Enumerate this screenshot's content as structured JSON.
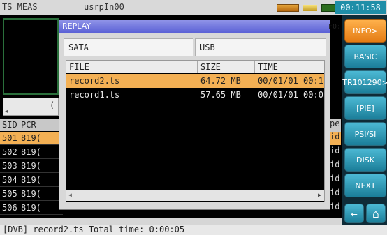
{
  "topbar": {
    "app_title": "TS MEAS",
    "user": "usrpIn00",
    "clock": "00:11:58",
    "icons": [
      "storage-icon",
      "signal-icon",
      "battery-icon"
    ]
  },
  "background_table": {
    "headers": [
      "SID",
      "PCR"
    ],
    "rows": [
      {
        "sid": "501",
        "pcr": "819(",
        "right": "id",
        "selected": true
      },
      {
        "sid": "502",
        "pcr": "819(",
        "right": "id",
        "selected": false
      },
      {
        "sid": "503",
        "pcr": "819(",
        "right": "id",
        "selected": false
      },
      {
        "sid": "504",
        "pcr": "819(",
        "right": "id",
        "selected": false
      },
      {
        "sid": "505",
        "pcr": "819(",
        "right": "id",
        "selected": false
      },
      {
        "sid": "506",
        "pcr": "819(",
        "right": "id",
        "selected": false
      }
    ],
    "right_header": "pe",
    "left_scroll_glyph": "("
  },
  "status_bar": "[DVB] record2.ts Total time: 0:00:05",
  "side_panel": {
    "buttons": [
      {
        "label": "INFO>",
        "active": true
      },
      {
        "label": "BASIC",
        "active": false
      },
      {
        "label": "TR101290>",
        "active": false
      },
      {
        "label": "[PIE]",
        "active": false
      },
      {
        "label": "PSI/SI",
        "active": false
      },
      {
        "label": "DISK",
        "active": false
      },
      {
        "label": "NEXT",
        "active": false
      }
    ],
    "back_icon": "←",
    "home_icon": "⌂"
  },
  "dialog": {
    "title": "REPLAY",
    "tabs": [
      "SATA",
      "USB"
    ],
    "columns": [
      "FILE",
      "SIZE",
      "TIME"
    ],
    "files": [
      {
        "file": "record2.ts",
        "size": "64.72 MB",
        "time": "00/01/01 00:1(",
        "selected": true
      },
      {
        "file": "record1.ts",
        "size": "57.65 MB",
        "time": "00/01/01 00:0(",
        "selected": false
      }
    ],
    "right_edge_label": "F0:"
  }
}
